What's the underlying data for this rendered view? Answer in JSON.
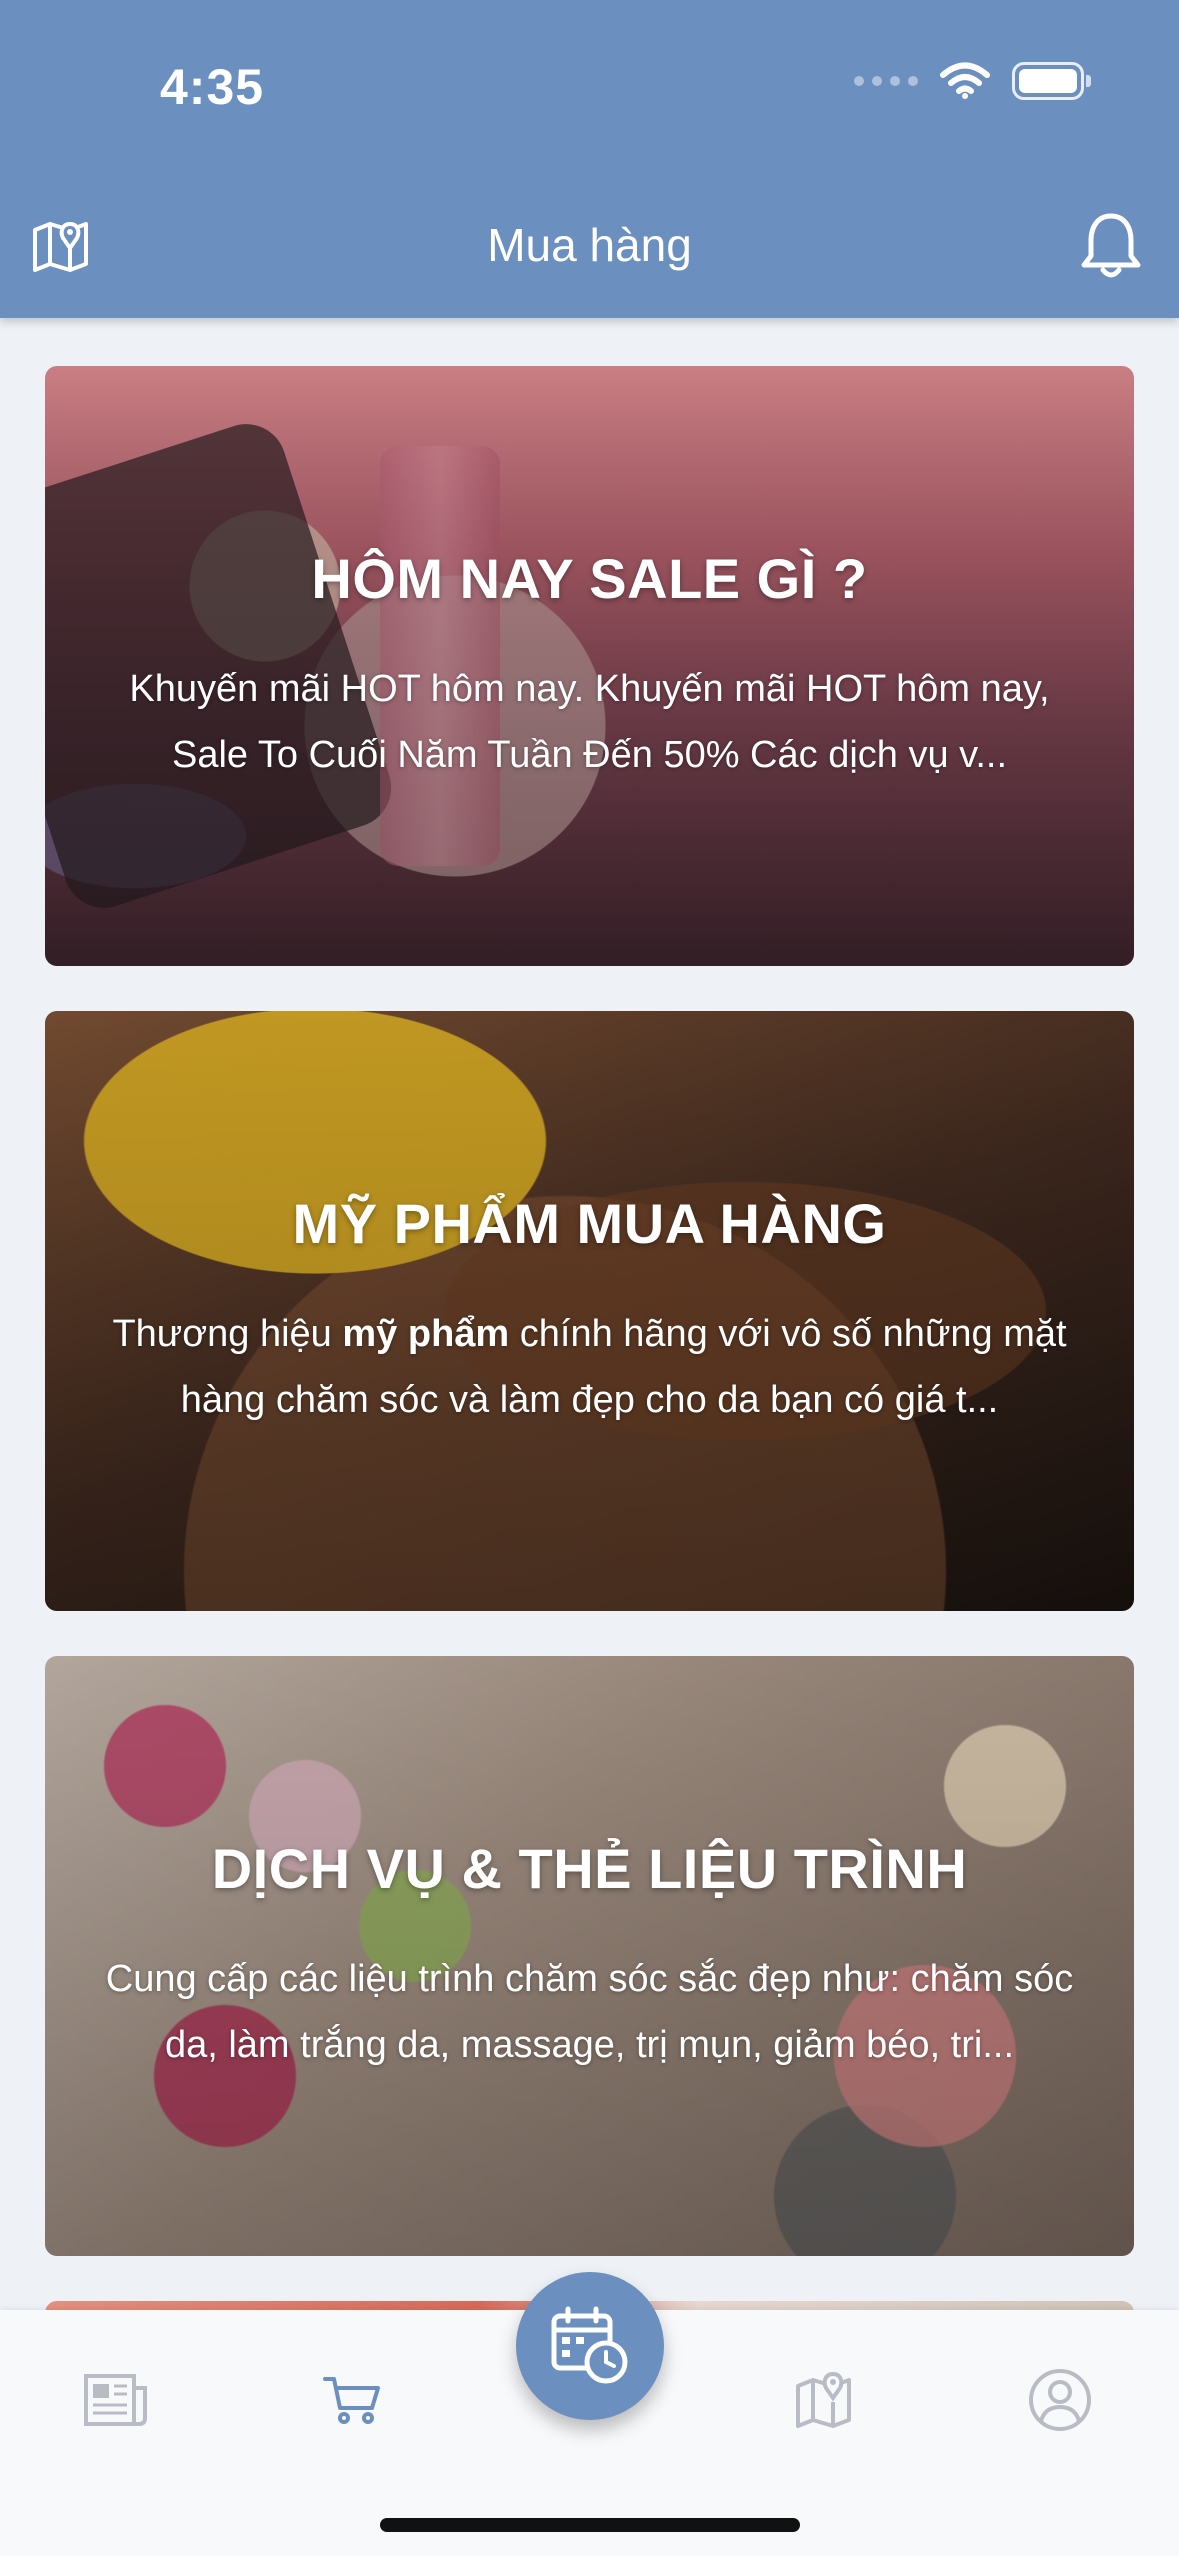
{
  "status_bar": {
    "time": "4:35"
  },
  "nav": {
    "title": "Mua hàng"
  },
  "cards": [
    {
      "title": "HÔM NAY SALE GÌ ?",
      "description": "Khuyến mãi HOT hôm nay. Khuyến mãi HOT hôm nay, Sale To Cuối Năm Tuần Đến 50% Các dịch vụ v..."
    },
    {
      "title": "MỸ PHẨM MUA HÀNG",
      "description_prefix": "Thương hiệu ",
      "description_bold": "mỹ phẩm",
      "description_suffix": " chính hãng với vô số những mặt hàng chăm sóc và làm đẹp cho da bạn có giá t..."
    },
    {
      "title": "DỊCH VỤ & THẺ LIỆU TRÌNH",
      "description": "Cung cấp các liệu trình chăm sóc sắc đẹp như: chăm sóc da, làm trắng da, massage, trị mụn, giảm béo, tri..."
    }
  ],
  "tabs": [
    {
      "name": "news",
      "icon": "newspaper-icon",
      "active": false
    },
    {
      "name": "shop",
      "icon": "cart-icon",
      "active": true
    },
    {
      "name": "booking",
      "icon": "calendar-clock-icon",
      "active": false
    },
    {
      "name": "map",
      "icon": "map-pin-icon",
      "active": false
    },
    {
      "name": "profile",
      "icon": "user-circle-icon",
      "active": false
    }
  ],
  "colors": {
    "primary": "#6b8fbf",
    "tab_inactive": "#b8bcc4",
    "tab_active": "#6b8fbf",
    "background": "#eef2f6"
  }
}
